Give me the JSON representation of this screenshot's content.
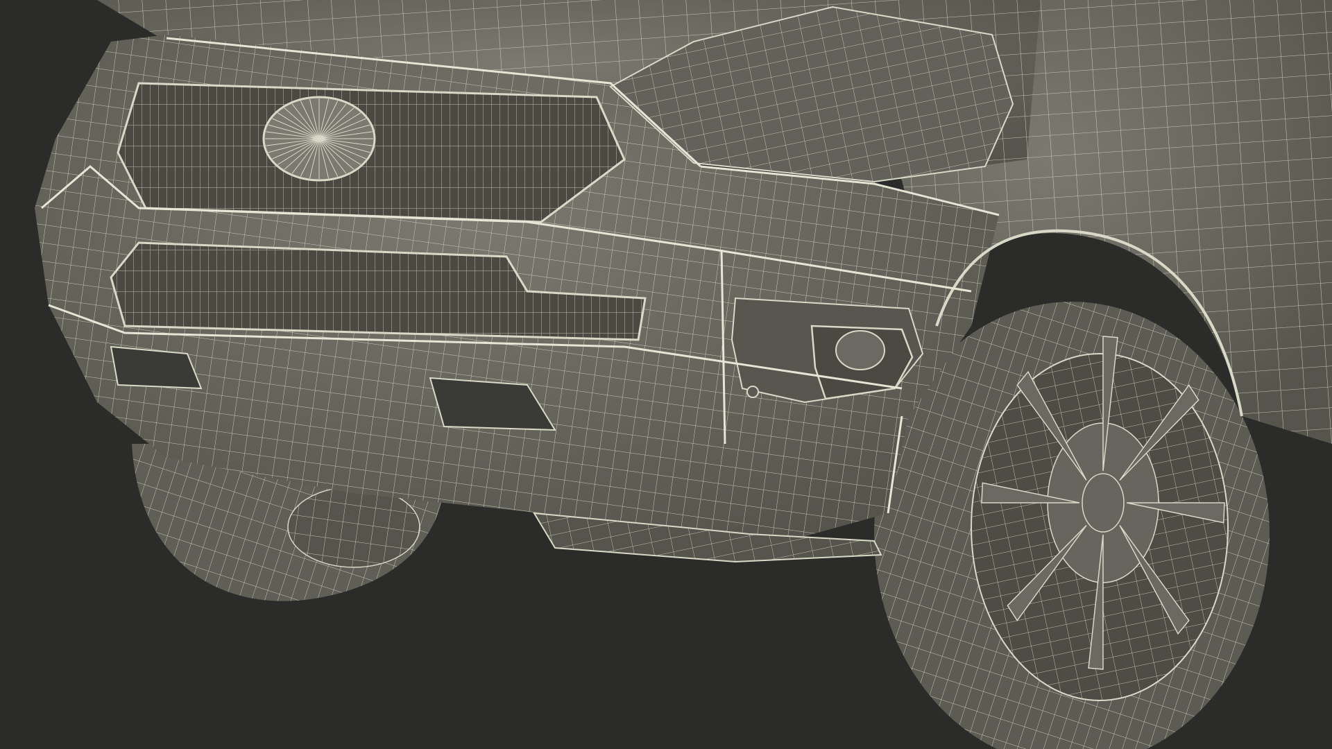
{
  "scene": {
    "background_color": "#2b2b29",
    "surface_color": "#6b6b62",
    "surface_light": "#8a8a80",
    "surface_dark": "#4a4a43",
    "wire_color": "#d9d9c8",
    "cavity_color": "#3a3a36"
  }
}
